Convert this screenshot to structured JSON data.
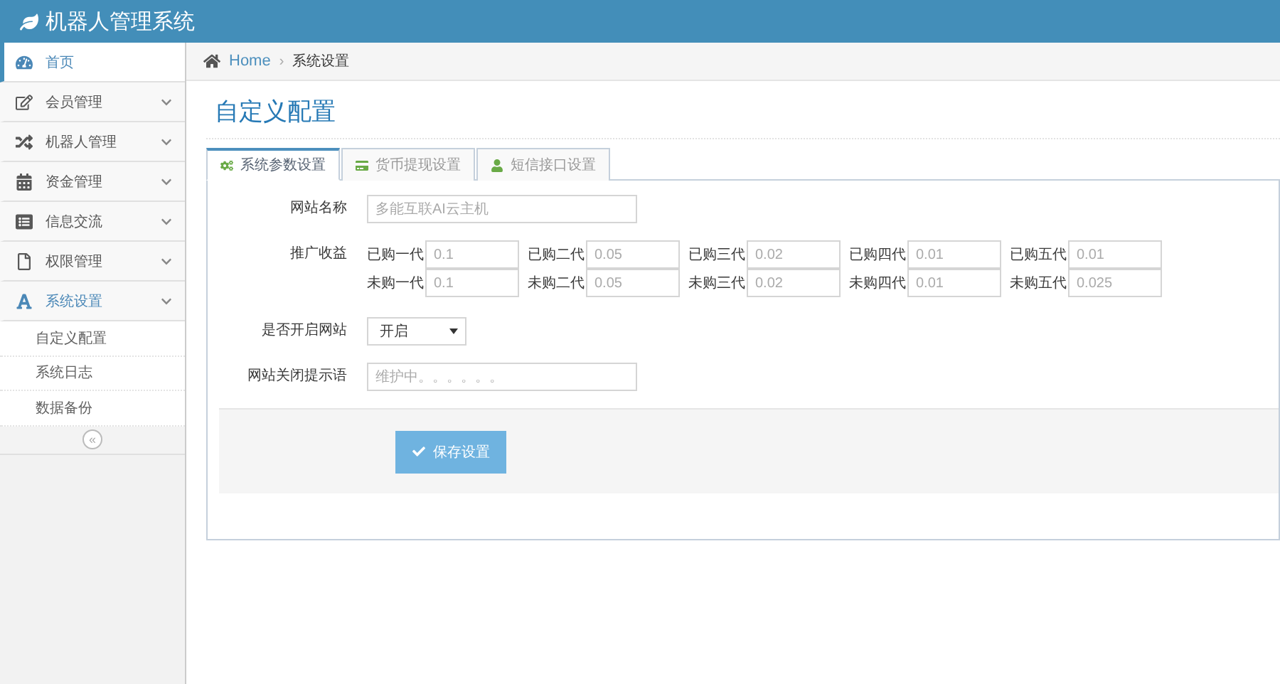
{
  "app": {
    "title": "机器人管理系统"
  },
  "sidebar": {
    "items": [
      {
        "label": "首页",
        "selected": true,
        "expanded": false,
        "has_caret": false
      },
      {
        "label": "会员管理",
        "selected": false,
        "expanded": false,
        "has_caret": true
      },
      {
        "label": "机器人管理",
        "selected": false,
        "expanded": false,
        "has_caret": true
      },
      {
        "label": "资金管理",
        "selected": false,
        "expanded": false,
        "has_caret": true
      },
      {
        "label": "信息交流",
        "selected": false,
        "expanded": false,
        "has_caret": true
      },
      {
        "label": "权限管理",
        "selected": false,
        "expanded": false,
        "has_caret": true
      },
      {
        "label": "系统设置",
        "selected": false,
        "expanded": true,
        "has_caret": true,
        "children": [
          {
            "label": "自定义配置"
          },
          {
            "label": "系统日志"
          },
          {
            "label": "数据备份"
          }
        ]
      }
    ],
    "collapse_symbol": "«"
  },
  "breadcrumb": {
    "home": "Home",
    "separator": "›",
    "current": "系统设置"
  },
  "page_title": "自定义配置",
  "tabs": [
    {
      "label": "系统参数设置",
      "selected": true
    },
    {
      "label": "货币提现设置",
      "selected": false
    },
    {
      "label": "短信接口设置",
      "selected": false
    }
  ],
  "form": {
    "site_name": {
      "label": "网站名称",
      "placeholder": "多能互联AI云主机"
    },
    "reward": {
      "label": "推广收益",
      "rows": [
        [
          {
            "label": "已购一代",
            "placeholder": "0.1"
          },
          {
            "label": "已购二代",
            "placeholder": "0.05"
          },
          {
            "label": "已购三代",
            "placeholder": "0.02"
          },
          {
            "label": "已购四代",
            "placeholder": "0.01"
          },
          {
            "label": "已购五代",
            "placeholder": "0.01"
          }
        ],
        [
          {
            "label": "未购一代",
            "placeholder": "0.1"
          },
          {
            "label": "未购二代",
            "placeholder": "0.05"
          },
          {
            "label": "未购三代",
            "placeholder": "0.02"
          },
          {
            "label": "未购四代",
            "placeholder": "0.01"
          },
          {
            "label": "未购五代",
            "placeholder": "0.025"
          }
        ]
      ]
    },
    "site_open": {
      "label": "是否开启网站",
      "value": "开启"
    },
    "close_message": {
      "label": "网站关闭提示语",
      "placeholder": "维护中。。。。。。"
    },
    "save_button": "保存设置"
  }
}
